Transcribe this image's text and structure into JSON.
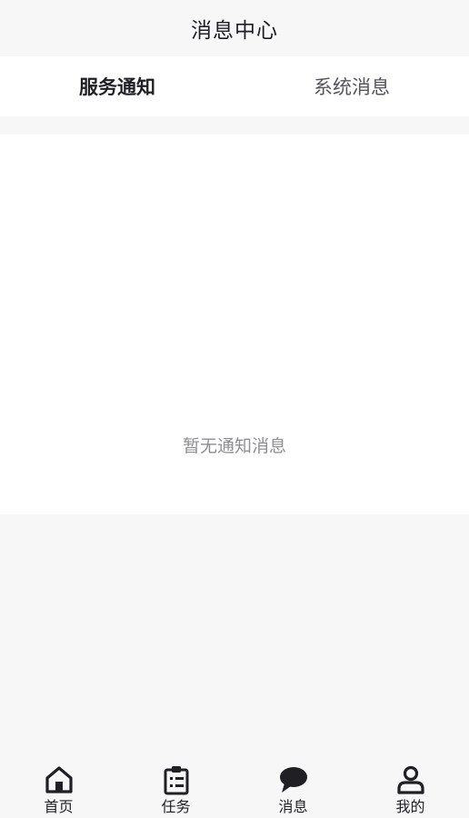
{
  "navbar": {
    "title": "消息中心"
  },
  "tabs": [
    {
      "label": "服务通知",
      "active": true
    },
    {
      "label": "系统消息",
      "active": false
    }
  ],
  "content": {
    "empty_text": "暂无通知消息"
  },
  "tabbar": {
    "items": [
      {
        "label": "首页",
        "icon": "home-icon"
      },
      {
        "label": "任务",
        "icon": "clipboard-list-icon"
      },
      {
        "label": "消息",
        "icon": "chat-bubble-icon"
      },
      {
        "label": "我的",
        "icon": "user-icon"
      }
    ]
  },
  "colors": {
    "text_primary": "#1f1f24",
    "text_secondary": "#55555c",
    "text_muted": "#8e8e93",
    "background": "#f7f7f7",
    "surface": "#ffffff"
  }
}
